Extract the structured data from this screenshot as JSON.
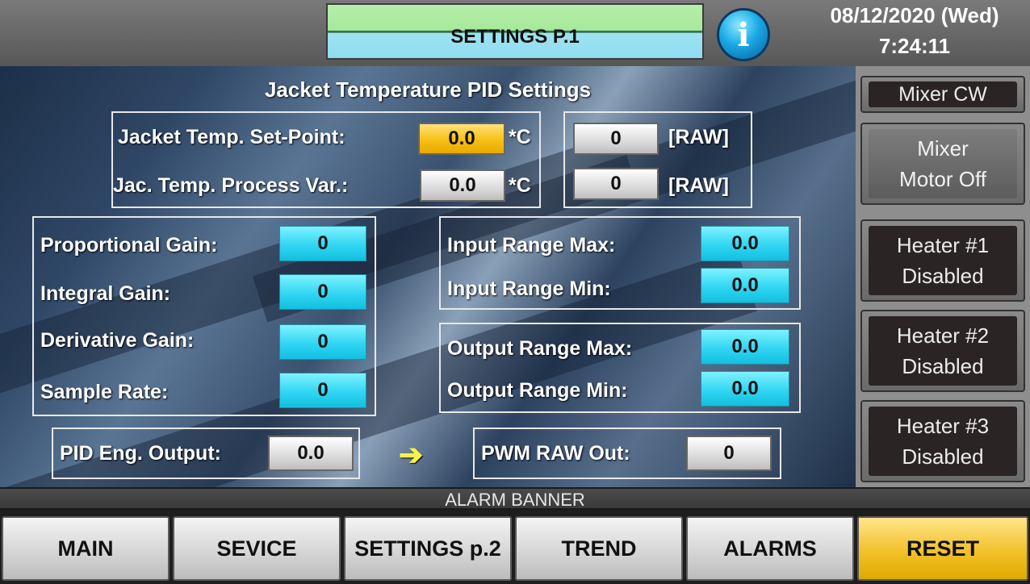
{
  "header": {
    "title": "SETTINGS P.1",
    "info_icon": "info-icon",
    "date": "08/12/2020 (Wed)",
    "time": "7:24:11"
  },
  "main": {
    "heading": "Jacket Temperature PID Settings",
    "setpoint": {
      "label": "Jacket Temp. Set-Point:",
      "value": "0.0",
      "unit": "*C",
      "raw_value": "0",
      "raw_unit": "[RAW]"
    },
    "process_var": {
      "label": "Jac. Temp. Process Var.:",
      "value": "0.0",
      "unit": "*C",
      "raw_value": "0",
      "raw_unit": "[RAW]"
    },
    "gains": [
      {
        "label": "Proportional Gain:",
        "value": "0"
      },
      {
        "label": "Integral Gain:",
        "value": "0"
      },
      {
        "label": "Derivative Gain:",
        "value": "0"
      },
      {
        "label": "Sample Rate:",
        "value": "0"
      }
    ],
    "input_range": [
      {
        "label": "Input Range Max:",
        "value": "0.0"
      },
      {
        "label": "Input Range Min:",
        "value": "0.0"
      }
    ],
    "output_range": [
      {
        "label": "Output Range Max:",
        "value": "0.0"
      },
      {
        "label": "Output Range Min:",
        "value": "0.0"
      }
    ],
    "pid_output": {
      "label": "PID Eng. Output:",
      "value": "0.0"
    },
    "arrow": "➔",
    "pwm_out": {
      "label": "PWM RAW Out:",
      "value": "0"
    }
  },
  "side": {
    "mixer_dir": "Mixer CW",
    "mixer_line1": "Mixer",
    "mixer_line2": "Motor Off",
    "heater1_line1": "Heater #1",
    "heater1_line2": "Disabled",
    "heater2_line1": "Heater #2",
    "heater2_line2": "Disabled",
    "heater3_line1": "Heater #3",
    "heater3_line2": "Disabled"
  },
  "alarm_banner": "ALARM BANNER",
  "nav": [
    {
      "label": "MAIN"
    },
    {
      "label": "SEVICE"
    },
    {
      "label": "SETTINGS p.2"
    },
    {
      "label": "TREND"
    },
    {
      "label": "ALARMS"
    },
    {
      "label": "RESET"
    }
  ],
  "colors": {
    "setpoint_field": "#f6bf14",
    "tuning_field": "#31d6f3",
    "reset_button": "#f2c12a",
    "arrow": "#f7f34a"
  }
}
